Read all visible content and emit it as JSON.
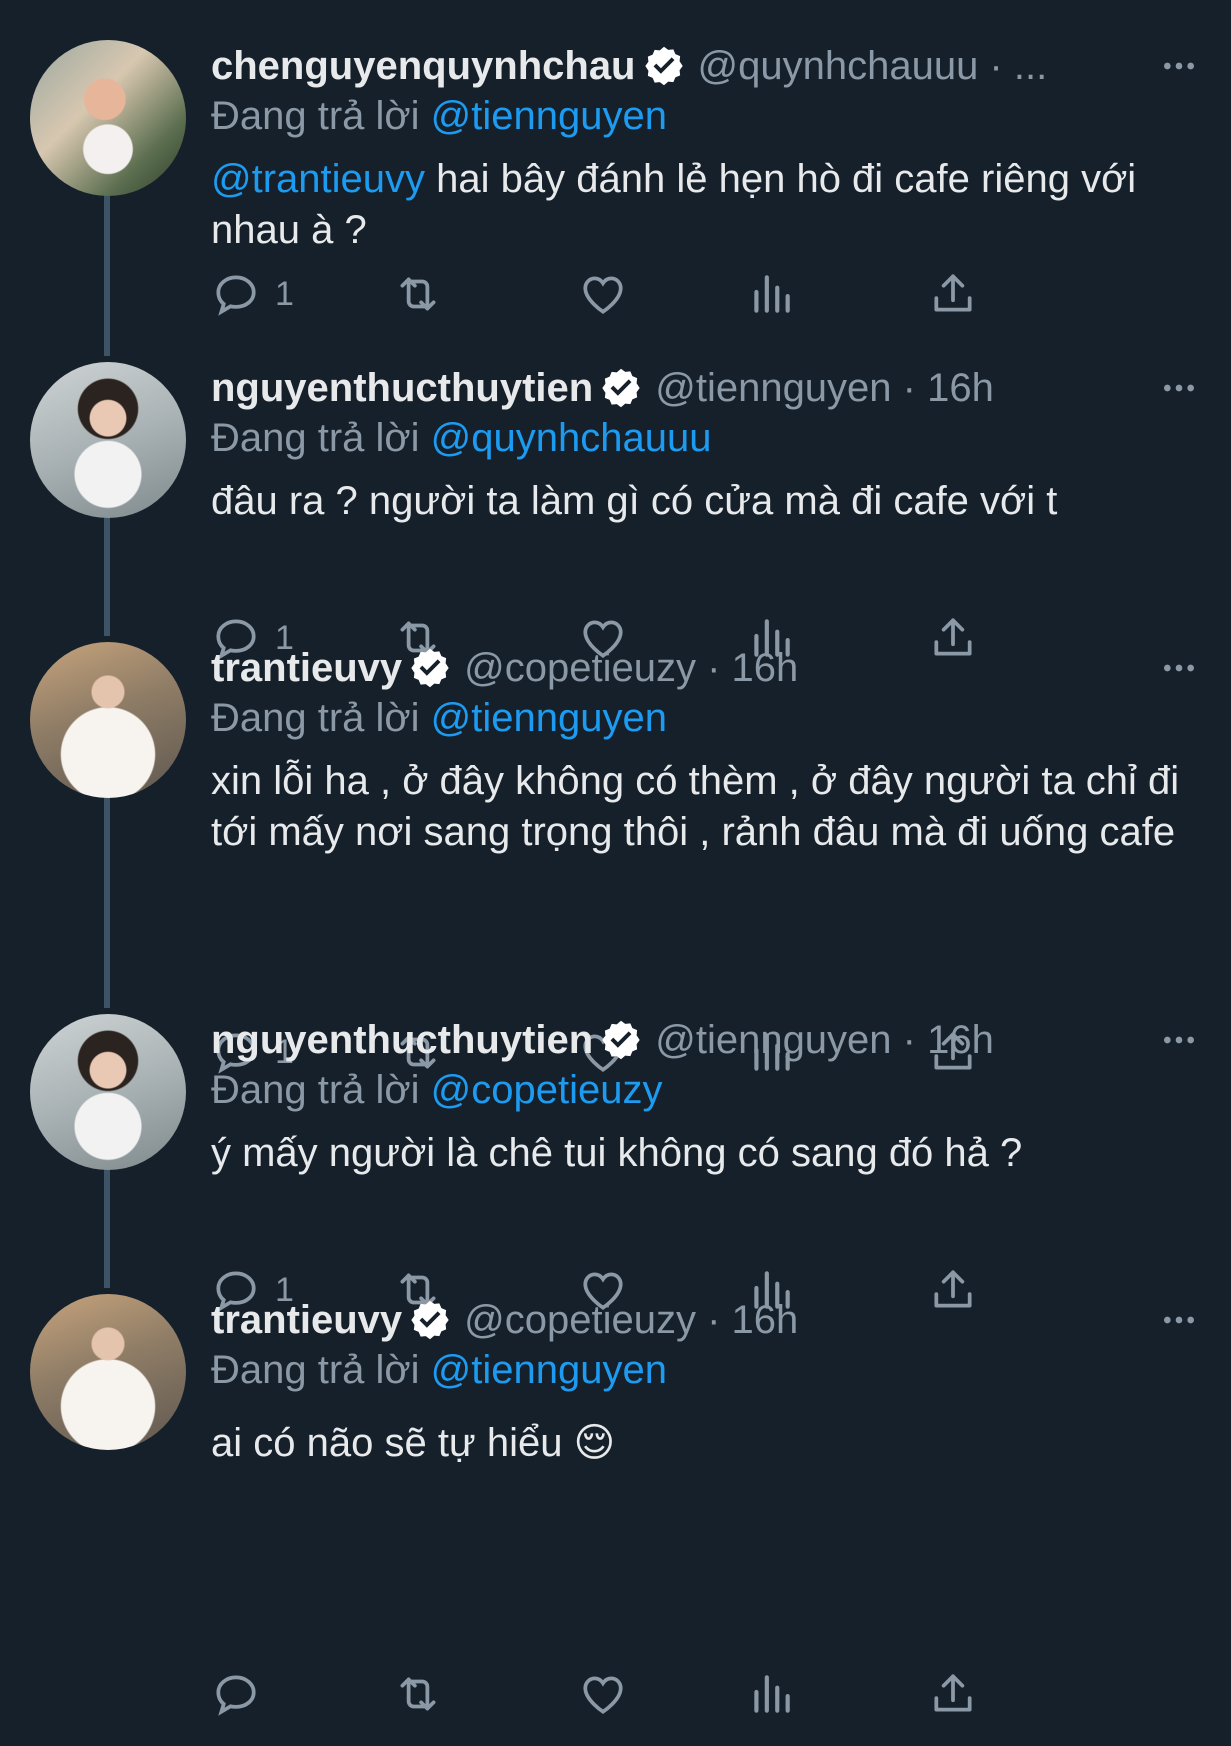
{
  "replying_prefix": "Đang trả lời",
  "tweets": [
    {
      "name": "chenguyenquynhchau",
      "handle": "@quynhchauuu · ...",
      "replying_to": "@tiennguyen",
      "text_mention": "@trantieuvy",
      "text": "hai bây đánh lẻ hẹn hò đi cafe riêng với nhau à ?",
      "reply_count": "1",
      "avatar": "avatar-chenguyenquynhchau"
    },
    {
      "name": "nguyenthucthuytien",
      "handle": "@tiennguyen · 16h",
      "replying_to": "@quynhchauuu",
      "text": "đâu ra ? người ta làm gì có cửa mà đi cafe với t",
      "reply_count": "1",
      "avatar": "avatar-nguyenthucthuytien"
    },
    {
      "name": "trantieuvy",
      "handle": "@copetieuzy · 16h",
      "replying_to": "@tiennguyen",
      "text": "xin lỗi ha , ở đây không có thèm , ở đây người ta chỉ đi tới mấy nơi sang trọng thôi , rảnh đâu mà đi uống cafe",
      "reply_count": "1",
      "avatar": "avatar-trantieuvy"
    },
    {
      "name": "nguyenthucthuytien",
      "handle": "@tiennguyen · 16h",
      "replying_to": "@copetieuzy",
      "text": "ý mấy người là chê tui không có sang đó hả ?",
      "reply_count": "1",
      "avatar": "avatar-nguyenthucthuytien"
    },
    {
      "name": "trantieuvy",
      "handle": "@copetieuzy · 16h",
      "replying_to": "@tiennguyen",
      "text": "ai có não sẽ tự hiểu 😌",
      "reply_count": "",
      "avatar": "avatar-trantieuvy"
    }
  ],
  "icons": {
    "reply": "reply-icon",
    "retweet": "retweet-icon",
    "like": "heart-icon",
    "views": "views-icon",
    "share": "share-icon",
    "more": "more-icon",
    "verified": "verified-badge-icon"
  },
  "colors": {
    "background": "#15202b",
    "text": "#e7e9ea",
    "secondary": "#8b98a5",
    "accent": "#1d9bf0",
    "thread_line": "#3d5466"
  }
}
